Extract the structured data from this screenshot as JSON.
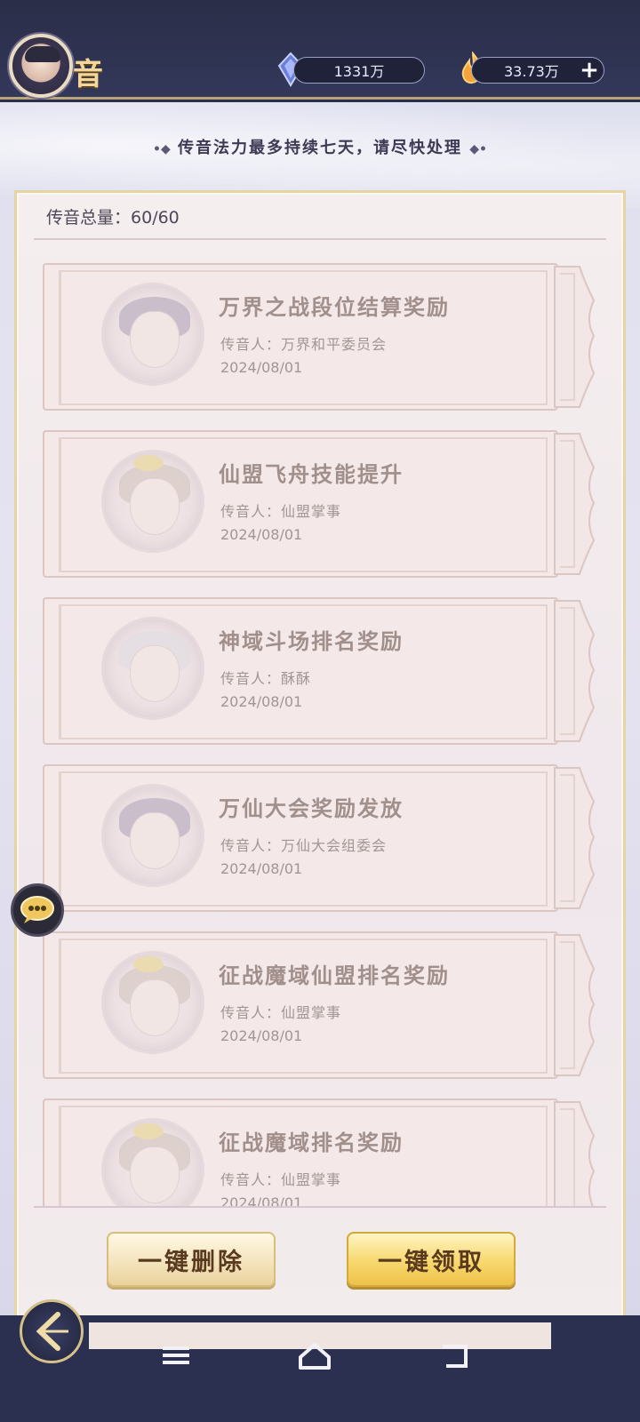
{
  "header": {
    "title": "音",
    "resources": [
      {
        "icon": "crystal-icon",
        "value": "1331万"
      },
      {
        "icon": "flame-icon",
        "value": "33.73万"
      }
    ],
    "add_label": "+"
  },
  "notice": {
    "text": "传音法力最多持续七天，请尽快处理",
    "decor_left": "•◆",
    "decor_right": "◆•"
  },
  "panel": {
    "count_label": "传音总量：",
    "count_value": "60/60"
  },
  "messages": [
    {
      "title": "万界之战段位结算奖励",
      "sender": "传音人：万界和平委员会",
      "date": "2024/08/01",
      "portrait": "dark"
    },
    {
      "title": "仙盟飞舟技能提升",
      "sender": "传音人：仙盟掌事",
      "date": "2024/08/01",
      "portrait": "gold"
    },
    {
      "title": "神域斗场排名奖励",
      "sender": "传音人：酥酥",
      "date": "2024/08/01",
      "portrait": "light"
    },
    {
      "title": "万仙大会奖励发放",
      "sender": "传音人：万仙大会组委会",
      "date": "2024/08/01",
      "portrait": "dark"
    },
    {
      "title": "征战魔域仙盟排名奖励",
      "sender": "传音人：仙盟掌事",
      "date": "2024/08/01",
      "portrait": "gold"
    },
    {
      "title": "征战魔域排名奖励",
      "sender": "传音人：仙盟掌事",
      "date": "2024/08/01",
      "portrait": "gold"
    }
  ],
  "actions": {
    "delete_all": "一键删除",
    "claim_all": "一键领取"
  },
  "colors": {
    "header_bg": "#2a2e48",
    "accent_gold": "#f4d59a",
    "claim_button": "#f8d86d"
  }
}
